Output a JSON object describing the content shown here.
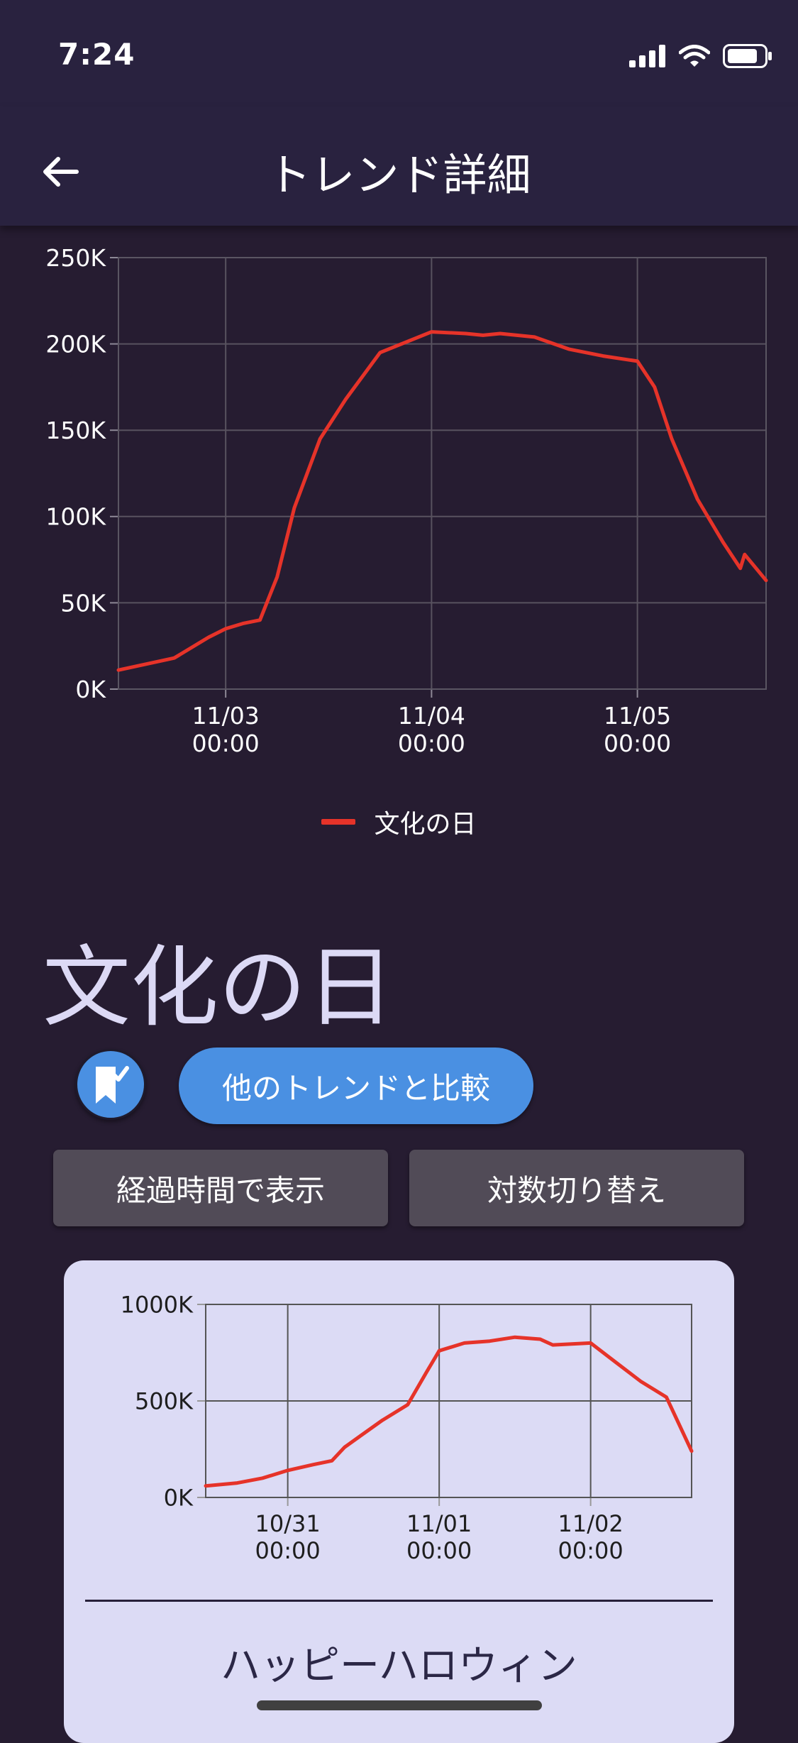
{
  "status_bar": {
    "time": "7:24"
  },
  "app_bar": {
    "title": "トレンド詳細"
  },
  "chart_data": [
    {
      "type": "line",
      "title": "",
      "xlabel": "",
      "ylabel": "",
      "ylim": [
        0,
        250000
      ],
      "yticks": [
        0,
        50000,
        100000,
        150000,
        200000,
        250000
      ],
      "ytick_labels": [
        "0K",
        "50K",
        "100K",
        "150K",
        "200K",
        "250K"
      ],
      "xlim": [
        "11/02 11:30",
        "11/05 15:00"
      ],
      "xtick_labels": [
        {
          "date": "11/03",
          "time": "00:00"
        },
        {
          "date": "11/04",
          "time": "00:00"
        },
        {
          "date": "11/05",
          "time": "00:00"
        }
      ],
      "grid": true,
      "legend": "bottom-center",
      "series": [
        {
          "name": "文化の日",
          "color": "#e63329",
          "points": [
            [
              "11/02 11:30",
              11000
            ],
            [
              "11/02 18:00",
              18000
            ],
            [
              "11/02 22:00",
              30000
            ],
            [
              "11/03 00:00",
              35000
            ],
            [
              "11/03 02:00",
              38000
            ],
            [
              "11/03 04:00",
              40000
            ],
            [
              "11/03 06:00",
              65000
            ],
            [
              "11/03 08:00",
              105000
            ],
            [
              "11/03 11:00",
              145000
            ],
            [
              "11/03 14:00",
              168000
            ],
            [
              "11/03 18:00",
              195000
            ],
            [
              "11/04 00:00",
              207000
            ],
            [
              "11/04 04:00",
              206000
            ],
            [
              "11/04 06:00",
              205000
            ],
            [
              "11/04 08:00",
              206000
            ],
            [
              "11/04 12:00",
              204000
            ],
            [
              "11/04 16:00",
              197000
            ],
            [
              "11/04 20:00",
              193000
            ],
            [
              "11/05 00:00",
              190000
            ],
            [
              "11/05 02:00",
              175000
            ],
            [
              "11/05 04:00",
              145000
            ],
            [
              "11/05 07:00",
              110000
            ],
            [
              "11/05 10:00",
              85000
            ],
            [
              "11/05 12:00",
              70000
            ],
            [
              "11/05 12:30",
              78000
            ],
            [
              "11/05 15:00",
              63000
            ]
          ]
        }
      ]
    },
    {
      "type": "line",
      "title": "",
      "xlabel": "",
      "ylabel": "",
      "ylim": [
        0,
        1000000
      ],
      "yticks": [
        0,
        500000,
        1000000
      ],
      "ytick_labels": [
        "0K",
        "500K",
        "1000K"
      ],
      "xlim": [
        "10/30 11:00",
        "11/02 16:00"
      ],
      "xtick_labels": [
        {
          "date": "10/31",
          "time": "00:00"
        },
        {
          "date": "11/01",
          "time": "00:00"
        },
        {
          "date": "11/02",
          "time": "00:00"
        }
      ],
      "grid": true,
      "series": [
        {
          "color": "#e63329",
          "points": [
            [
              "10/30 11:00",
              60000
            ],
            [
              "10/30 16:00",
              75000
            ],
            [
              "10/30 20:00",
              100000
            ],
            [
              "10/31 00:00",
              140000
            ],
            [
              "10/31 04:00",
              170000
            ],
            [
              "10/31 07:00",
              190000
            ],
            [
              "10/31 09:00",
              260000
            ],
            [
              "10/31 12:00",
              330000
            ],
            [
              "10/31 15:00",
              400000
            ],
            [
              "10/31 19:00",
              480000
            ],
            [
              "10/31 22:00",
              650000
            ],
            [
              "11/01 00:00",
              760000
            ],
            [
              "11/01 04:00",
              800000
            ],
            [
              "11/01 08:00",
              810000
            ],
            [
              "11/01 12:00",
              830000
            ],
            [
              "11/01 16:00",
              820000
            ],
            [
              "11/01 18:00",
              790000
            ],
            [
              "11/02 00:00",
              800000
            ],
            [
              "11/02 04:00",
              700000
            ],
            [
              "11/02 08:00",
              600000
            ],
            [
              "11/02 12:00",
              520000
            ],
            [
              "11/02 16:00",
              240000
            ]
          ]
        }
      ]
    }
  ],
  "trend": {
    "name": "文化の日",
    "compare_label": "他のトレンドと比較",
    "elapsed_label": "経過時間で表示",
    "log_label": "対数切り替え"
  },
  "related": {
    "name": "ハッピーハロウィン"
  },
  "icons": {
    "back": "arrow-left-icon",
    "bookmark": "bookmark-check-icon",
    "signal": "cellular-signal-icon",
    "wifi": "wifi-icon",
    "battery": "battery-icon"
  }
}
